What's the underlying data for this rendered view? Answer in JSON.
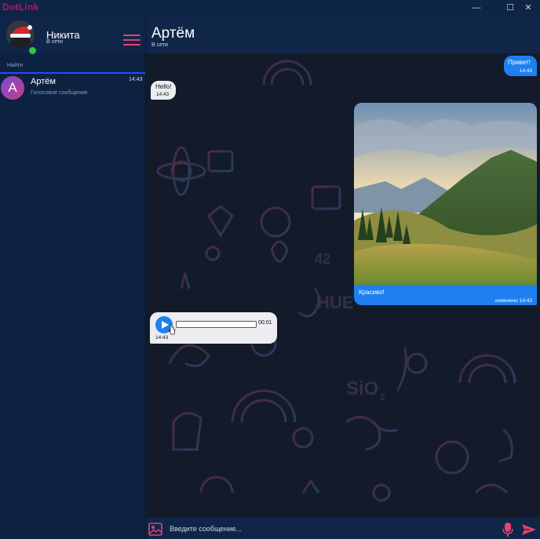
{
  "window": {
    "title": "DotLink",
    "min_glyph": "—",
    "max_glyph": "☐",
    "close_glyph": "✕"
  },
  "sidebar": {
    "me": {
      "name": "Никита",
      "status": "В сети",
      "online": true
    },
    "search_placeholder": "Найти",
    "chats": [
      {
        "avatar_letter": "A",
        "name": "Артём",
        "preview": "Голосовое сообщение",
        "time": "14:43"
      }
    ]
  },
  "header": {
    "peer_name": "Артём",
    "peer_status": "В сети"
  },
  "messages": [
    {
      "direction": "out",
      "type": "text",
      "text": "Привет!",
      "time": "14:43"
    },
    {
      "direction": "in",
      "type": "text",
      "text": "Hello!",
      "time": "14:43"
    },
    {
      "direction": "out",
      "type": "image",
      "caption": "Красиво!",
      "time": "изменено 14:43",
      "image": "mountain-landscape"
    },
    {
      "direction": "in",
      "type": "voice",
      "duration": "00:01",
      "time": "14:43",
      "progress": 0
    }
  ],
  "input": {
    "placeholder": "Введите сообщение..."
  },
  "icons": {
    "attach": "image-icon",
    "mic": "microphone-icon",
    "send": "send-icon",
    "menu": "hamburger-menu-icon"
  },
  "colors": {
    "accent": "#1e80f0",
    "brand": "#b0127c",
    "menu": "#e3436f",
    "online": "#27c93f",
    "search_underline": "#2449ff"
  }
}
